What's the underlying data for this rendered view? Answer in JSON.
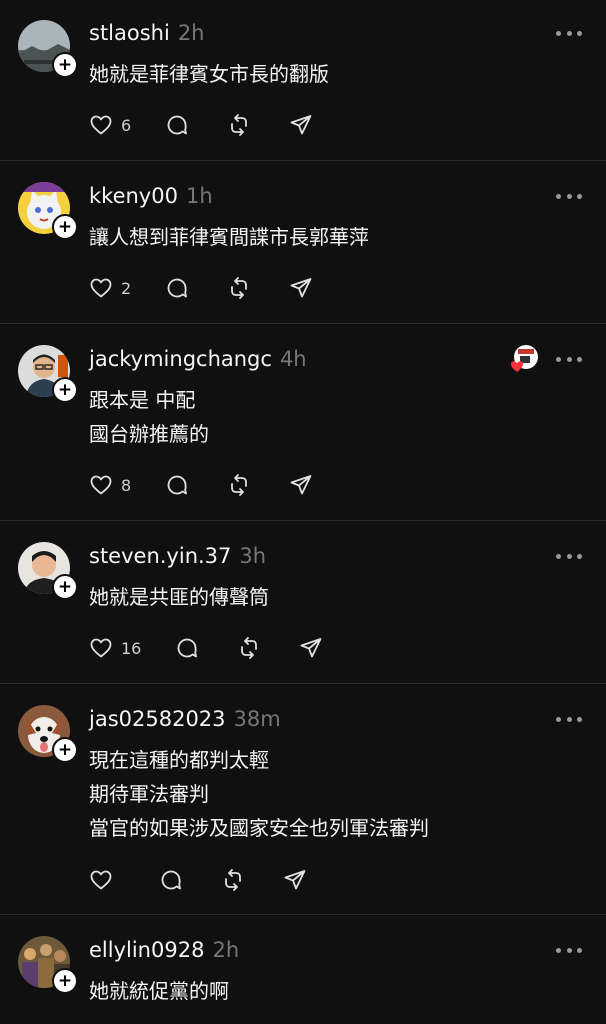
{
  "posts": [
    {
      "username": "stlaoshi",
      "time": "2h",
      "text": "她就是菲律賓女市長的翻版",
      "likes": "6",
      "avatar_icon": "landscape-photo"
    },
    {
      "username": "kkeny00",
      "time": "1h",
      "text": "讓人想到菲律賓間諜市長郭華萍",
      "likes": "2",
      "avatar_icon": "cartoon-cat"
    },
    {
      "username": "jackymingchangc",
      "time": "4h",
      "text": "跟本是 中配\n國台辦推薦的",
      "likes": "8",
      "avatar_icon": "man-glasses"
    },
    {
      "username": "steven.yin.37",
      "time": "3h",
      "text": "她就是共匪的傳聲筒",
      "likes": "16",
      "avatar_icon": "man-photo"
    },
    {
      "username": "jas02582023",
      "time": "38m",
      "text": "現在這種的都判太輕\n期待軍法審判\n當官的如果涉及國家安全也列軍法審判",
      "likes": "",
      "avatar_icon": "dog"
    },
    {
      "username": "ellylin0928",
      "time": "2h",
      "text": "她就統促黨的啊",
      "likes": "",
      "avatar_icon": "crowd-photo"
    }
  ],
  "colors": {
    "background": "#101010",
    "text": "#f3f5f7",
    "muted": "#777777",
    "divider": "#2a2a2a",
    "heart": "#ff3040"
  }
}
